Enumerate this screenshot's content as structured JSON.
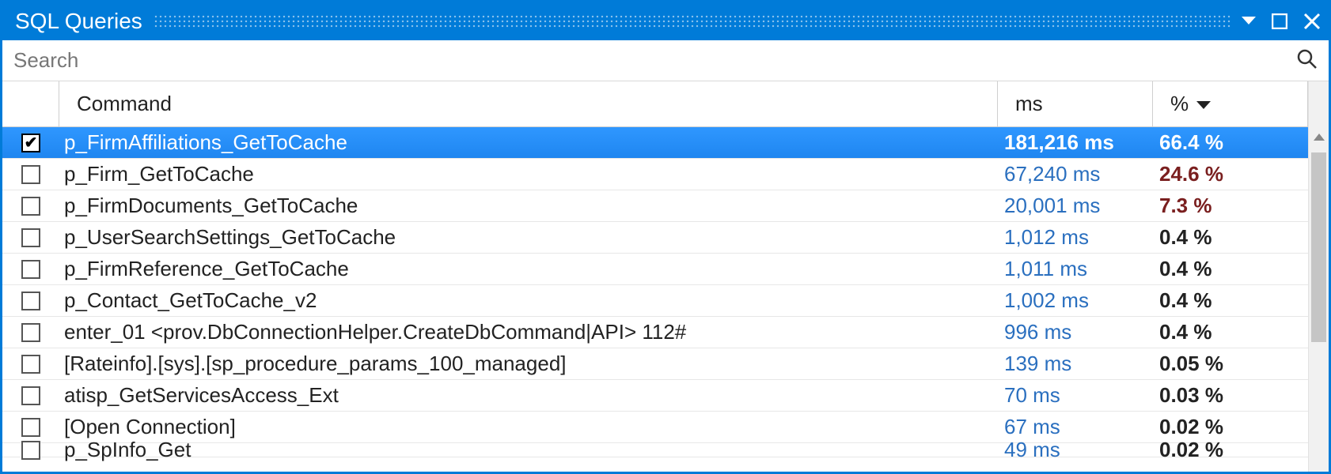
{
  "window": {
    "title": "SQL Queries"
  },
  "search": {
    "placeholder": "Search",
    "value": ""
  },
  "columns": {
    "command": "Command",
    "ms": "ms",
    "pct": "%"
  },
  "sort": {
    "column": "pct",
    "direction": "desc"
  },
  "rows": [
    {
      "checked": true,
      "selected": true,
      "command": "p_FirmAffiliations_GetToCache",
      "ms": "181,216 ms",
      "pct": "66.4 %",
      "pct_high": false
    },
    {
      "checked": false,
      "selected": false,
      "command": "p_Firm_GetToCache",
      "ms": "67,240 ms",
      "pct": "24.6 %",
      "pct_high": true
    },
    {
      "checked": false,
      "selected": false,
      "command": "p_FirmDocuments_GetToCache",
      "ms": "20,001 ms",
      "pct": "7.3 %",
      "pct_high": true
    },
    {
      "checked": false,
      "selected": false,
      "command": "p_UserSearchSettings_GetToCache",
      "ms": "1,012 ms",
      "pct": "0.4 %",
      "pct_high": false
    },
    {
      "checked": false,
      "selected": false,
      "command": "p_FirmReference_GetToCache",
      "ms": "1,011 ms",
      "pct": "0.4 %",
      "pct_high": false
    },
    {
      "checked": false,
      "selected": false,
      "command": "p_Contact_GetToCache_v2",
      "ms": "1,002 ms",
      "pct": "0.4 %",
      "pct_high": false
    },
    {
      "checked": false,
      "selected": false,
      "command": "enter_01 <prov.DbConnectionHelper.CreateDbCommand|API> 112#",
      "ms": "996 ms",
      "pct": "0.4 %",
      "pct_high": false
    },
    {
      "checked": false,
      "selected": false,
      "command": "[Rateinfo].[sys].[sp_procedure_params_100_managed]",
      "ms": "139 ms",
      "pct": "0.05 %",
      "pct_high": false
    },
    {
      "checked": false,
      "selected": false,
      "command": "atisp_GetServicesAccess_Ext",
      "ms": "70 ms",
      "pct": "0.03 %",
      "pct_high": false
    },
    {
      "checked": false,
      "selected": false,
      "command": "[Open Connection]",
      "ms": "67 ms",
      "pct": "0.02 %",
      "pct_high": false
    },
    {
      "checked": false,
      "selected": false,
      "command": "p_SpInfo_Get",
      "ms": "49 ms",
      "pct": "0.02 %",
      "pct_high": false,
      "partial": true
    }
  ]
}
